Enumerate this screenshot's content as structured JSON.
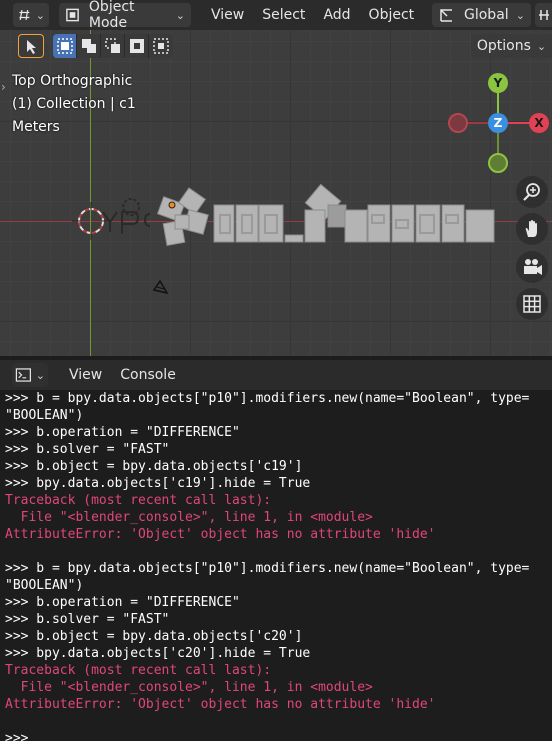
{
  "header": {
    "editor_icon": "3D Viewport",
    "mode_label": "Object Mode",
    "menus": [
      "View",
      "Select",
      "Add",
      "Object"
    ],
    "orientation_label": "Global",
    "options_label": "Options"
  },
  "overlay": {
    "view_name": "Top Orthographic",
    "collection": "(1) Collection | c1",
    "units": "Meters"
  },
  "gizmo": {
    "y_label": "Y",
    "z_label": "Z",
    "x_label": "X",
    "colors": {
      "x": "#e04253",
      "y": "#8bc53f",
      "z": "#3a8fe0"
    }
  },
  "nav_icons": [
    "zoom-icon",
    "hand-icon",
    "camera-icon",
    "grid-icon"
  ],
  "console": {
    "menus": [
      "View",
      "Console"
    ],
    "lines": [
      {
        "text": ">>> b = bpy.data.objects[\"p10\"].modifiers.new(name=\"Boolean\", type=",
        "type": "input"
      },
      {
        "text": "\"BOOLEAN\")",
        "type": "input"
      },
      {
        "text": ">>> b.operation = \"DIFFERENCE\"",
        "type": "input"
      },
      {
        "text": ">>> b.solver = \"FAST\"",
        "type": "input"
      },
      {
        "text": ">>> b.object = bpy.data.objects['c19']",
        "type": "input"
      },
      {
        "text": ">>> bpy.data.objects['c19'].hide = True",
        "type": "input"
      },
      {
        "text": "Traceback (most recent call last):",
        "type": "error"
      },
      {
        "text": "  File \"<blender_console>\", line 1, in <module>",
        "type": "error"
      },
      {
        "text": "AttributeError: 'Object' object has no attribute 'hide'",
        "type": "error"
      },
      {
        "text": "",
        "type": "input"
      },
      {
        "text": ">>> b = bpy.data.objects[\"p10\"].modifiers.new(name=\"Boolean\", type=",
        "type": "input"
      },
      {
        "text": "\"BOOLEAN\")",
        "type": "input"
      },
      {
        "text": ">>> b.operation = \"DIFFERENCE\"",
        "type": "input"
      },
      {
        "text": ">>> b.solver = \"FAST\"",
        "type": "input"
      },
      {
        "text": ">>> b.object = bpy.data.objects['c20']",
        "type": "input"
      },
      {
        "text": ">>> bpy.data.objects['c20'].hide = True",
        "type": "input"
      },
      {
        "text": "Traceback (most recent call last):",
        "type": "error"
      },
      {
        "text": "  File \"<blender_console>\", line 1, in <module>",
        "type": "error"
      },
      {
        "text": "AttributeError: 'Object' object has no attribute 'hide'",
        "type": "error"
      },
      {
        "text": "",
        "type": "input"
      },
      {
        "text": ">>>",
        "type": "input"
      }
    ]
  }
}
